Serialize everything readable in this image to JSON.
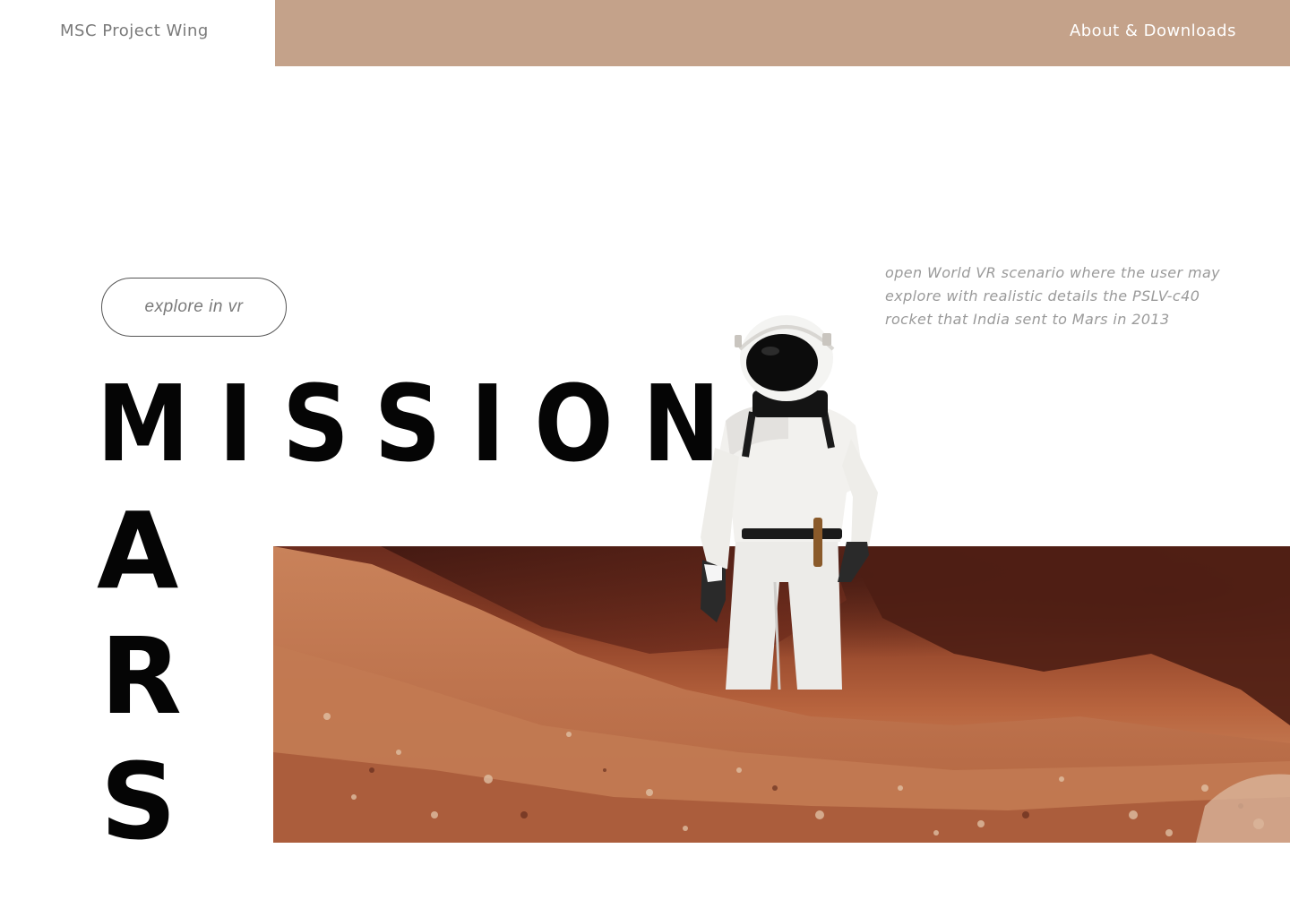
{
  "header": {
    "site_name": "MSC Project Wing",
    "nav_link": "About & Downloads"
  },
  "hero": {
    "explore_button": "explore in vr",
    "description": "open World VR scenario where the user may explore with realistic details the PSLV-c40 rocket that India sent to Mars in 2013",
    "title_word_1": "MISSION",
    "title_word_2_letters": [
      "A",
      "R",
      "S"
    ]
  },
  "colors": {
    "accent": "#c4a28a",
    "title": "#050505",
    "muted_text": "#7a7a7a",
    "description_text": "#9a9a9a"
  },
  "images": {
    "hero_photo": "astronaut-on-mars-photo"
  }
}
